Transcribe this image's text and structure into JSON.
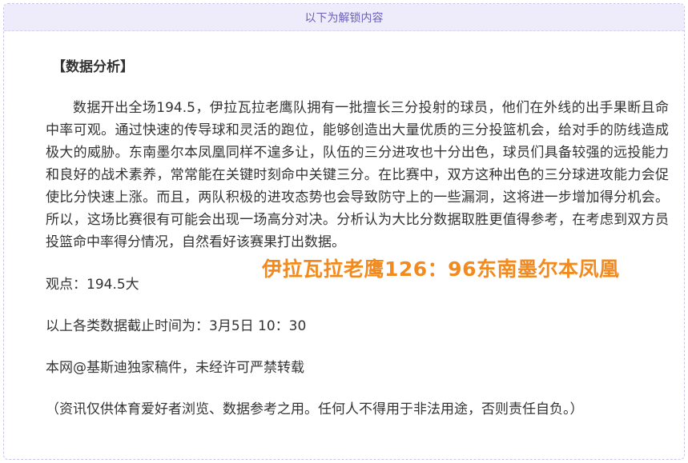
{
  "unlock_bar": {
    "label": "以下为解锁内容"
  },
  "article": {
    "section_title": "【数据分析】",
    "paragraph": "数据开出全场194.5，伊拉瓦拉老鹰队拥有一批擅长三分投射的球员，他们在外线的出手果断且命中率可观。通过快速的传导球和灵活的跑位，能够创造出大量优质的三分投篮机会，给对手的防线造成极大的威胁。东南墨尔本凤凰同样不遑多让，队伍的三分进攻也十分出色，球员们具备较强的远投能力和良好的战术素养，常常能在关键时刻命中关键三分。在比赛中，双方这种出色的三分球进攻能力会促使比分快速上涨。而且，两队积极的进攻态势也会导致防守上的一些漏洞，这将进一步增加得分机会。所以，这场比赛很有可能会出现一场高分对决。分析认为大比分数据取胜更值得参考，在考虑到双方员投篮命中率得分情况，自然看好该赛果打出数据。",
    "verdict": "观点：194.5大",
    "cutoff_time": "以上各类数据截止时间为：3月5日 10：30",
    "copyright": "本网@基斯迪独家稿件，未经许可严禁转载",
    "disclaimer": "（资讯仅供体育爱好者浏览、数据参考之用。任何人不得用于非法用途，否则责任自负。）"
  },
  "result_overlay": {
    "text": "伊拉瓦拉老鹰126：96东南墨尔本凤凰",
    "color": "#f28a1e"
  }
}
